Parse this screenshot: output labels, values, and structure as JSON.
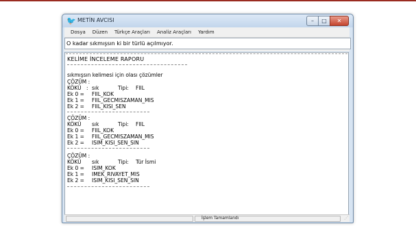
{
  "window": {
    "title": "METİN AVCISI",
    "icon": "bird-icon"
  },
  "controls": {
    "minimize": "–",
    "maximize": "□",
    "close": "✕"
  },
  "menu": [
    "Dosya",
    "Düzen",
    "Türkçe Araçları",
    "Analiz Araçları",
    "Yardım"
  ],
  "input": {
    "value": "O kadar sıkmışsın ki bir türlü açılmıyor."
  },
  "report": {
    "title": "KELİME İNCELEME RAPORU",
    "subtitle": "sıkmışsın kelimesi için olası çözümler",
    "solutions": [
      {
        "header": "ÇÖZÜM  :",
        "root_label": "KÖKÜ",
        "root_sep": ":",
        "root": "sık",
        "type_label": "Tipi:",
        "type": "FIIL",
        "suffixes": [
          {
            "label": "Ek 0 =",
            "value": "FIIL_KOK"
          },
          {
            "label": "Ek 1 =",
            "value": "FIIL_GECMISZAMAN_MIS"
          },
          {
            "label": "Ek 2 =",
            "value": "FIIL_KISI_SEN"
          }
        ]
      },
      {
        "header": "ÇÖZÜM  :",
        "root_label": "KÖKÜ",
        "root_sep": "",
        "root": "sık",
        "type_label": "Tipi:",
        "type": "FIIL",
        "suffixes": [
          {
            "label": "Ek 0 =",
            "value": "FIIL_KOK"
          },
          {
            "label": "Ek 1 =",
            "value": "FIIL_GECMISZAMAN_MIS"
          },
          {
            "label": "Ek 2 =",
            "value": "ISIM_KISI_SEN_SIN"
          }
        ]
      },
      {
        "header": "ÇÖZÜM  :",
        "root_label": "KÖKÜ",
        "root_sep": "",
        "root": "sık",
        "type_label": "Tipi:",
        "type": "Tür İsmi",
        "suffixes": [
          {
            "label": "Ek 0 =",
            "value": "ISIM_KOK"
          },
          {
            "label": "Ek 1 =",
            "value": "IMEK_RIVAYET_MIS"
          },
          {
            "label": "Ek 2 =",
            "value": "ISIM_KISI_SEN_SIN"
          }
        ]
      }
    ]
  },
  "status": {
    "text": "İşlem Tamamlandı"
  },
  "colors": {
    "accent_rule": "#9a2a20",
    "window_frame": "#d7e4f2"
  }
}
